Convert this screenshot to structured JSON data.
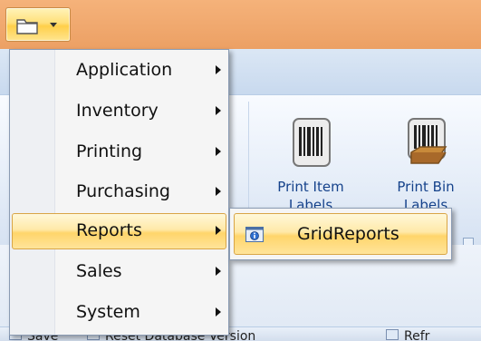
{
  "ribbon": {
    "buttons": [
      {
        "label_line1": "Print Item",
        "label_line2": "Labels"
      },
      {
        "label_line1": "Print Bin",
        "label_line2": "Labels"
      }
    ]
  },
  "bottom_toolbar": {
    "items": [
      "Save",
      "Reset Database Version",
      "Refr"
    ]
  },
  "app_menu": {
    "items": [
      {
        "label": "Application",
        "has_submenu": true
      },
      {
        "label": "Inventory",
        "has_submenu": true
      },
      {
        "label": "Printing",
        "has_submenu": true
      },
      {
        "label": "Purchasing",
        "has_submenu": true
      },
      {
        "label": "Reports",
        "has_submenu": true,
        "highlighted": true
      },
      {
        "label": "Sales",
        "has_submenu": true
      },
      {
        "label": "System",
        "has_submenu": true
      }
    ]
  },
  "sub_menu": {
    "items": [
      {
        "label": "GridReports",
        "icon": "report-icon"
      }
    ]
  },
  "colors": {
    "title_bar": "#eca064",
    "ribbon_text": "#15428b",
    "highlight": "#ffd56b",
    "highlight_border": "#d9a546"
  }
}
